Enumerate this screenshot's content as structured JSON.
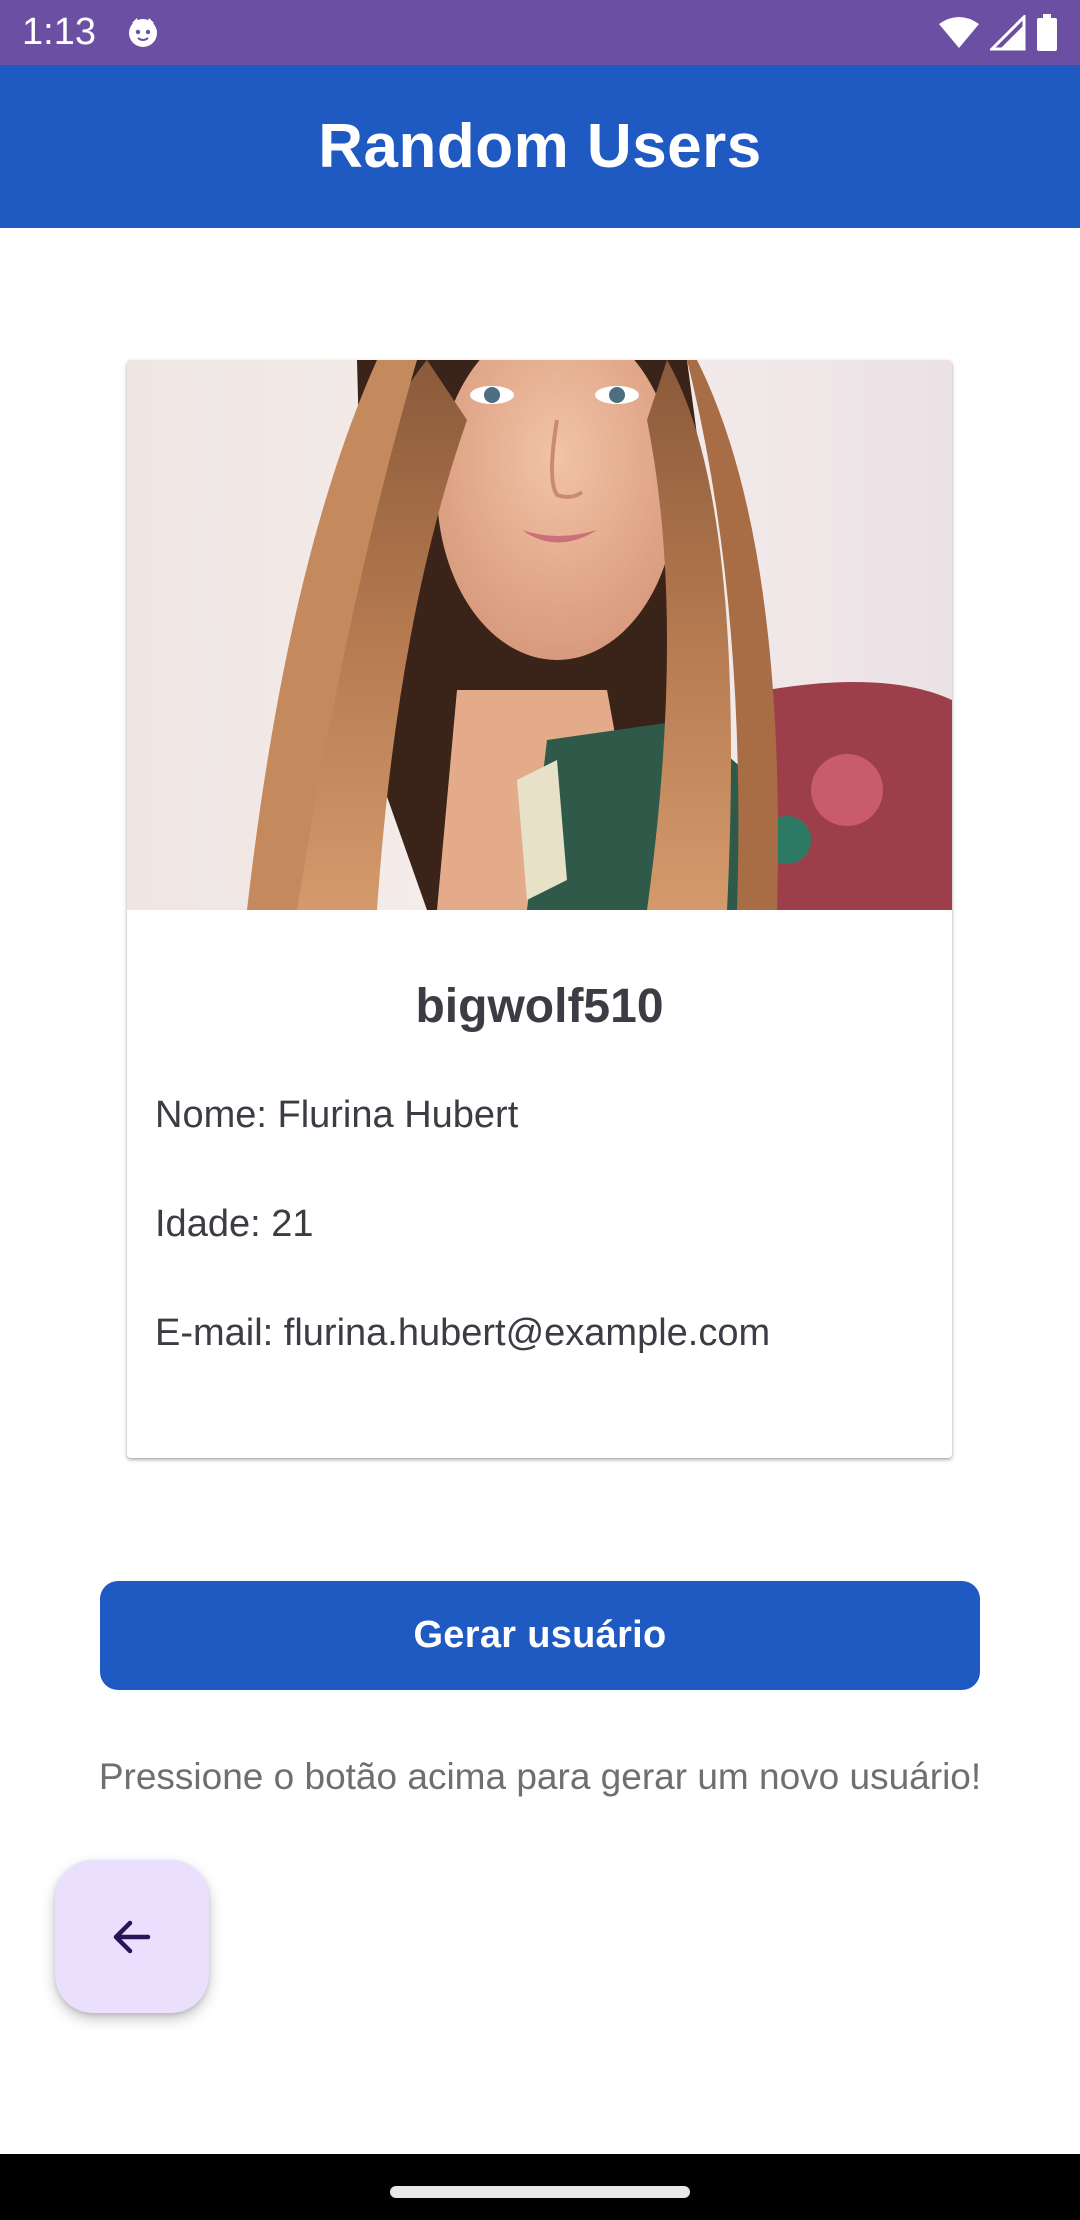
{
  "status_bar": {
    "time": "1:13",
    "icons": [
      "cat-notification-icon",
      "wifi-icon",
      "signal-icon",
      "battery-icon"
    ]
  },
  "app_bar": {
    "title": "Random Users"
  },
  "user_card": {
    "photo_icon": "user-photo",
    "username": "bigwolf510",
    "name_line": "Nome: Flurina Hubert",
    "age_line": "Idade: 21",
    "email_line": "E-mail: flurina.hubert@example.com"
  },
  "actions": {
    "generate_label": "Gerar usuário",
    "hint": "Pressione o botão acima para gerar um novo usuário!",
    "back_icon": "arrow-back-icon"
  },
  "colors": {
    "status_bar": "#6a4fa3",
    "primary": "#1f59c2",
    "fab_background": "#eadffc",
    "fab_icon": "#2a1457",
    "text_primary": "#3c3c44",
    "text_secondary": "#6f6f73"
  }
}
